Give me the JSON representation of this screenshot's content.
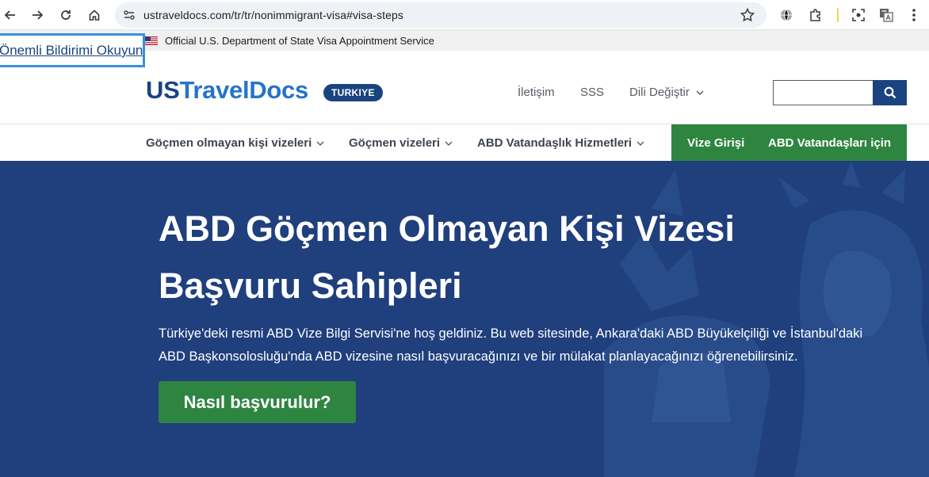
{
  "browser": {
    "url": "ustraveldocs.com/tr/tr/nonimmigrant-visa#visa-steps"
  },
  "banner": {
    "official_text": "Official U.S. Department of State Visa Appointment Service",
    "skip_link": "Önemli Bildirimi Okuyun"
  },
  "header": {
    "logo_primary": "US",
    "logo_accent": "TravelDocs",
    "country": "TURKIYE",
    "links": [
      "İletişim",
      "SSS",
      "Dili Değiştir"
    ],
    "search_placeholder": ""
  },
  "nav": {
    "items": [
      "Göçmen olmayan kişi vizeleri",
      "Göçmen vizeleri",
      "ABD Vatandaşlık Hizmetleri"
    ],
    "green_items": [
      "Vize Girişi",
      "ABD Vatandaşları için"
    ]
  },
  "hero": {
    "title_line1": "ABD Göçmen Olmayan Kişi Vizesi",
    "title_line2": "Başvuru Sahipleri",
    "intro_line1": "Türkiye'deki resmi ABD Vize Bilgi Servisi'ne hoş geldiniz. Bu web sitesinde, Ankara'daki ABD Büyükelçiliği ve İstanbul'daki",
    "intro_line2": "ABD Başkonsolosluğu'nda ABD vizesine nasıl başvuracağınızı ve bir mülakat planlayacağınızı öğrenebilirsiniz.",
    "cta": "Nasıl başvurulur?"
  },
  "colors": {
    "brand_navy": "#1a4480",
    "brand_blue": "#2673c9",
    "nav_green": "#2e8540",
    "hero_bg": "#1f3f7d"
  }
}
